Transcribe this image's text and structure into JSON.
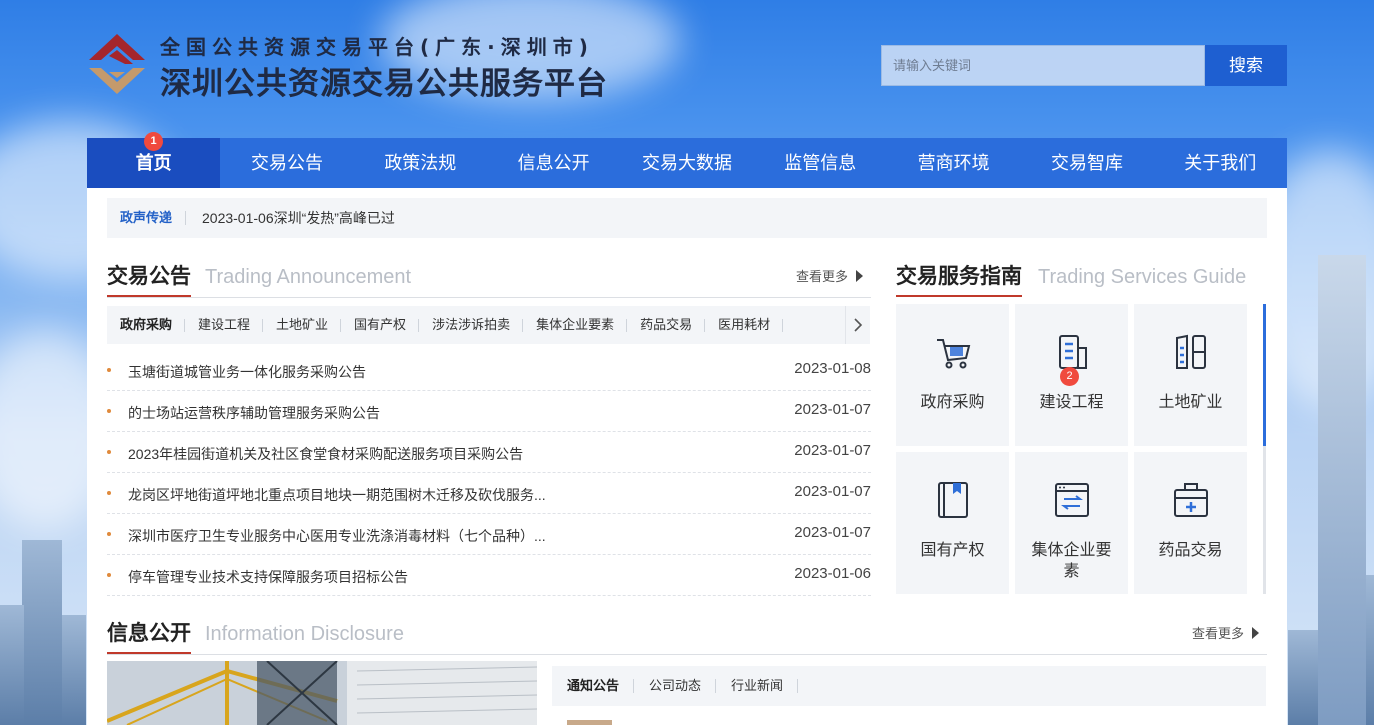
{
  "header": {
    "subtitle": "全国公共资源交易平台(广东·深圳市)",
    "title": "深圳公共资源交易公共服务平台",
    "search_placeholder": "请输入关键词",
    "search_button": "搜索"
  },
  "nav": {
    "items": [
      "首页",
      "交易公告",
      "政策法规",
      "信息公开",
      "交易大数据",
      "监管信息",
      "营商环境",
      "交易智库",
      "关于我们"
    ],
    "active_index": 0,
    "badge": "1"
  },
  "ticker": {
    "label": "政声传递",
    "text": "2023-01-06深圳“发热”高峰已过"
  },
  "announcements": {
    "title": "交易公告",
    "title_en": "Trading Announcement",
    "more": "查看更多",
    "categories": [
      "政府采购",
      "建设工程",
      "土地矿业",
      "国有产权",
      "涉法涉诉拍卖",
      "集体企业要素",
      "药品交易",
      "医用耗材"
    ],
    "active_category": 0,
    "items": [
      {
        "title": "玉塘街道城管业务一体化服务采购公告",
        "date": "2023-01-08"
      },
      {
        "title": "的士场站运营秩序辅助管理服务采购公告",
        "date": "2023-01-07"
      },
      {
        "title": "2023年桂园街道机关及社区食堂食材采购配送服务项目采购公告",
        "date": "2023-01-07"
      },
      {
        "title": "龙岗区坪地街道坪地北重点项目地块一期范围树木迁移及砍伐服务...",
        "date": "2023-01-07"
      },
      {
        "title": "深圳市医疗卫生专业服务中心医用专业洗涤消毒材料（七个品种）...",
        "date": "2023-01-07"
      },
      {
        "title": "停车管理专业技术支持保障服务项目招标公告",
        "date": "2023-01-06"
      }
    ]
  },
  "guide": {
    "title": "交易服务指南",
    "title_en": "Trading Services Guide",
    "items": [
      {
        "label": "政府采购",
        "icon": "cart-icon"
      },
      {
        "label": "建设工程",
        "icon": "building-icon",
        "badge": "2"
      },
      {
        "label": "土地矿业",
        "icon": "land-icon"
      },
      {
        "label": "国有产权",
        "icon": "bookmark-book-icon"
      },
      {
        "label": "集体企业要素",
        "icon": "transfer-window-icon"
      },
      {
        "label": "药品交易",
        "icon": "medical-kit-icon"
      }
    ]
  },
  "info": {
    "title": "信息公开",
    "title_en": "Information Disclosure",
    "more": "查看更多",
    "tabs": [
      "通知公告",
      "公司动态",
      "行业新闻"
    ],
    "active_tab": 0
  },
  "colors": {
    "nav_bg": "#2b6ddc",
    "nav_active": "#1a4dbf",
    "accent_red": "#c0392b",
    "search_button": "#1e5fd1"
  }
}
